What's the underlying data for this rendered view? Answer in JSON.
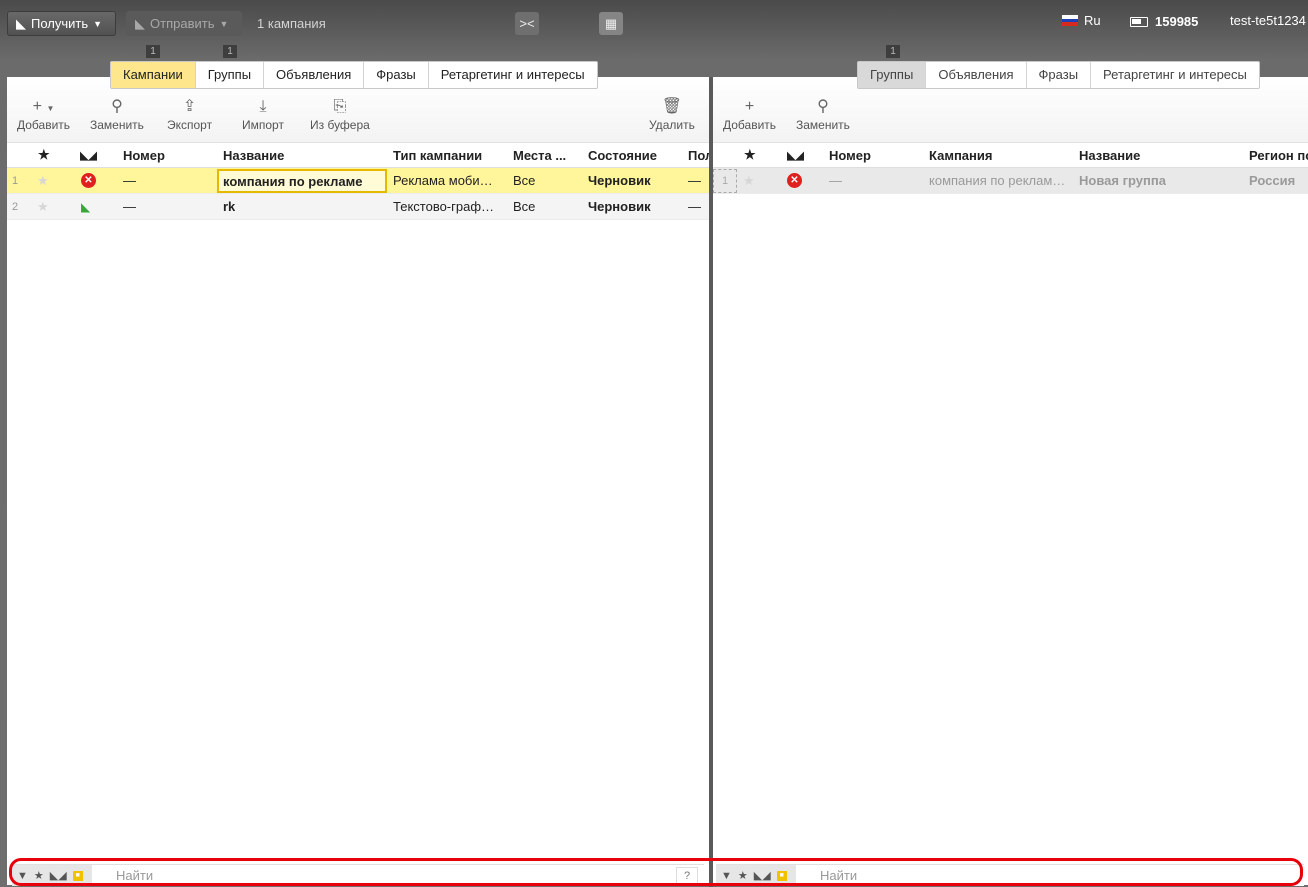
{
  "topbar": {
    "get_label": "Получить",
    "send_label": "Отправить",
    "count_label": "1 кампания",
    "lang_label": "Ru",
    "balance": "159985",
    "username": "test-te5t1234"
  },
  "left": {
    "tabs": [
      {
        "label": "Кампании",
        "badge": "1"
      },
      {
        "label": "Группы",
        "badge": "1"
      },
      {
        "label": "Объявления"
      },
      {
        "label": "Фразы"
      },
      {
        "label": "Ретаргетинг и интересы"
      }
    ],
    "toolbar": {
      "add": "Добавить",
      "replace": "Заменить",
      "export": "Экспорт",
      "import": "Импорт",
      "clipboard": "Из буфера",
      "delete": "Удалить"
    },
    "columns": {
      "number": "Номер",
      "name": "Название",
      "type": "Тип кампании",
      "places": "Места ...",
      "state": "Состояние",
      "extra": "Пол"
    },
    "rows": [
      {
        "index": "1",
        "number": "—",
        "name": "компания по рекламе",
        "type": "Реклама моби…",
        "places": "Все",
        "state": "Черновик",
        "extra": "—"
      },
      {
        "index": "2",
        "number": "—",
        "name": "rk",
        "type": "Текстово-граф…",
        "places": "Все",
        "state": "Черновик",
        "extra": "—"
      }
    ],
    "filter": {
      "placeholder": "Найти",
      "help": "?"
    }
  },
  "right": {
    "tabs": [
      {
        "label": "Группы",
        "badge": "1"
      },
      {
        "label": "Объявления"
      },
      {
        "label": "Фразы"
      },
      {
        "label": "Ретаргетинг и интересы"
      }
    ],
    "toolbar": {
      "add": "Добавить",
      "replace": "Заменить"
    },
    "columns": {
      "number": "Номер",
      "campaign": "Кампания",
      "name": "Название",
      "region": "Регион по"
    },
    "rows": [
      {
        "index": "1",
        "number": "—",
        "campaign": "компания по реклам…",
        "name": "Новая группа",
        "region": "Россия"
      }
    ],
    "filter": {
      "placeholder": "Найти"
    }
  },
  "colors": {
    "accent_tab": "#fde68b",
    "selected_row": "#fff59a",
    "highlight": "#e8000b"
  }
}
